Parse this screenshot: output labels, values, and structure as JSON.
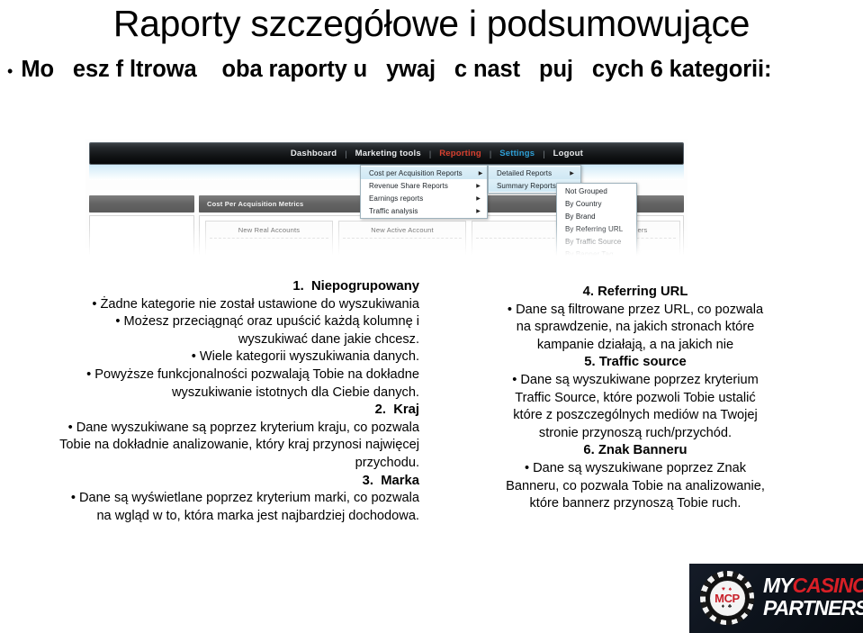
{
  "slide": {
    "title": "Raporty szczegółowe i podsumowujące",
    "subtitle_bullet": "•",
    "subtitle": "Mo   esz f ltrowa    oba raporty u   ywaj   c nast   puj   cych 6 kategorii:"
  },
  "screenshot": {
    "navbar": {
      "items": [
        {
          "label": "Dashboard",
          "color": "#e8eaec"
        },
        {
          "label": "Marketing tools",
          "color": "#e8eaec"
        },
        {
          "label": "Reporting",
          "color": "#d8402f"
        },
        {
          "label": "Settings",
          "color": "#2e9fd6"
        },
        {
          "label": "Logout",
          "color": "#e8eaec"
        }
      ],
      "separator": "|"
    },
    "menu_level1": [
      {
        "label": "Cost per Acquisition Reports",
        "arrow": "▶",
        "highlighted": true
      },
      {
        "label": "Revenue Share Reports",
        "arrow": "▶",
        "highlighted": false
      },
      {
        "label": "Earnings reports",
        "arrow": "▶",
        "highlighted": false
      },
      {
        "label": "Traffic analysis",
        "arrow": "▶",
        "highlighted": false
      }
    ],
    "menu_level2": [
      {
        "label": "Detailed Reports",
        "arrow": "▶",
        "highlighted": true
      },
      {
        "label": "Summary Reports",
        "arrow": "▶",
        "highlighted": true
      }
    ],
    "menu_level3": [
      {
        "label": "Not Grouped"
      },
      {
        "label": "By Country"
      },
      {
        "label": "By Brand"
      },
      {
        "label": "By Referring URL"
      },
      {
        "label": "By Traffic Source"
      },
      {
        "label": "By Banner Tag"
      }
    ],
    "section_bar_left": "",
    "section_bar_right": "Cost Per Acquisition Metrics",
    "cards": [
      {
        "title": "New Real Accounts"
      },
      {
        "title": "New Active Account"
      },
      {
        "title": ""
      },
      {
        "title": "ers"
      }
    ]
  },
  "left_column": {
    "item1_number": "1.",
    "item1_title": "Niepogrupowany",
    "item1_bullets": [
      "• Żadne kategorie nie został ustawione do wyszukiwania",
      "• Możesz przeciągnąć oraz upuścić każdą kolumnę i wyszukiwać dane jakie chcesz.",
      "• Wiele kategorii wyszukiwania danych.",
      "• Powyższe funkcjonalności pozwalają Tobie na dokładne wyszukiwanie istotnych dla Ciebie danych."
    ],
    "item2_number": "2.",
    "item2_title": "Kraj",
    "item2_bullets": [
      "• Dane wyszukiwane są poprzez kryterium kraju, co pozwala Tobie na dokładnie analizowanie, który kraj przynosi najwięcej przychodu."
    ],
    "item3_number": "3.",
    "item3_title": "Marka",
    "item3_bullets": [
      "• Dane są wyświetlane poprzez kryterium marki, co pozwala na wgląd w to, która marka jest najbardziej dochodowa."
    ]
  },
  "right_column": {
    "item4_number": "4.",
    "item4_title": "Referring URL",
    "item4_bullets": [
      "• Dane są filtrowane przez URL, co pozwala na sprawdzenie,  na jakich stronach które kampanie działają, a na jakich nie"
    ],
    "item5_number": "5.",
    "item5_title": "Traffic source",
    "item5_bullets": [
      "• Dane są wyszukiwane poprzez kryterium  Traffic Source, które pozwoli Tobie ustalić które z poszczególnych mediów  na Twojej stronie przynoszą ruch/przychód."
    ],
    "item6_number": "6.",
    "item6_title": "Znak Banneru",
    "item6_bullets": [
      "• Dane są wyszukiwane poprzez Znak Banneru, co pozwala Tobie na analizowanie, które bannerz przynoszą Tobie ruch."
    ]
  },
  "logo": {
    "chip_top_suits": "♥ ♠",
    "chip_text": "MCP",
    "chip_bottom_suits": "♦ ♣",
    "word_my": "MY",
    "word_casino": "CASINO",
    "word_partners": "PARTNERS",
    "accent_color": "#d91f26"
  }
}
